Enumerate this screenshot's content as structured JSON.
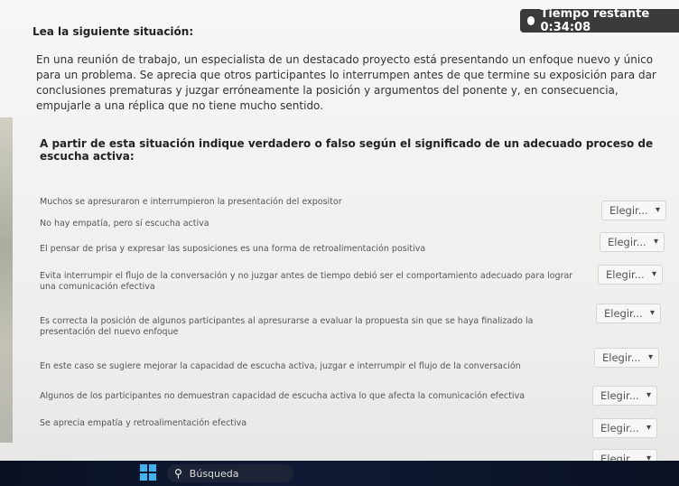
{
  "timer": {
    "label": "Tiempo restante 0:34:08"
  },
  "heading": "Lea la siguiente situación:",
  "intro": "En una reunión de trabajo, un especialista de un destacado proyecto está presentando un enfoque nuevo y único para un problema. Se aprecia que otros participantes lo interrumpen antes de que termine su exposición para dar conclusiones prematuras y juzgar erróneamente la posición y argumentos del ponente y, en consecuencia, empujarle a una réplica que no tiene mucho sentido.",
  "prompt": "A partir de esta situación indique verdadero o falso según el significado de un adecuado proceso de escucha activa:",
  "select_placeholder": "Elegir...",
  "items": [
    {
      "text": "Muchos se apresuraron e interrumpieron la presentación del expositor"
    },
    {
      "text": "No hay empatía, pero sí escucha activa"
    },
    {
      "text": "El pensar de prisa y expresar las suposiciones es una forma de retroalimentación positiva"
    },
    {
      "text": "Evita interrumpir el flujo de la conversación y no juzgar antes de tiempo debió ser el comportamiento adecuado para lograr una comunicación efectiva"
    },
    {
      "text": "Es correcta la posición de algunos participantes al apresurarse a evaluar la propuesta sin que se haya finalizado la presentación del nuevo enfoque"
    },
    {
      "text": "En este caso se sugiere mejorar la capacidad de escucha activa, juzgar e interrumpir el flujo de la conversación"
    },
    {
      "text": "Algunos de los participantes no demuestran capacidad de escucha activa lo que afecta la comunicación efectiva"
    },
    {
      "text": "Se aprecia empatía y retroalimentación efectiva"
    }
  ],
  "taskbar": {
    "search_label": "Búsqueda"
  }
}
